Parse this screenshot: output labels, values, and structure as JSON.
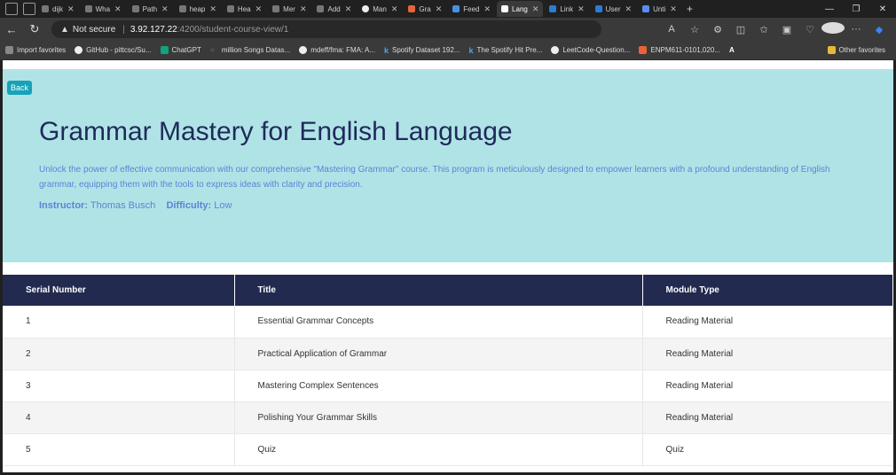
{
  "browser": {
    "tabs": [
      {
        "label": "dijk",
        "icon": "generic-tab-icon"
      },
      {
        "label": "Wha",
        "icon": "generic-tab-icon"
      },
      {
        "label": "Path",
        "icon": "generic-tab-icon"
      },
      {
        "label": "heap",
        "icon": "generic-tab-icon"
      },
      {
        "label": "Hea",
        "icon": "generic-tab-icon"
      },
      {
        "label": "Mer",
        "icon": "generic-tab-icon"
      },
      {
        "label": "Add",
        "icon": "generic-tab-icon"
      },
      {
        "label": "Man",
        "icon": "github-icon"
      },
      {
        "label": "Gra",
        "icon": "generic-tab-icon"
      },
      {
        "label": "Feed",
        "icon": "generic-tab-icon"
      },
      {
        "label": "Lang",
        "icon": "angular-icon",
        "active": true
      },
      {
        "label": "Link",
        "icon": "generic-tab-icon"
      },
      {
        "label": "User",
        "icon": "generic-tab-icon"
      },
      {
        "label": "Unti",
        "icon": "generic-tab-icon"
      }
    ],
    "not_secure": "Not secure",
    "url_host": "3.92.127.22",
    "url_path": ":4200/student-course-view/1",
    "bookmarks": [
      "Import favorites",
      "GitHub - pittcsc/Su...",
      "ChatGPT",
      "million Songs Datas...",
      "mdeff/fma: FMA: A...",
      "Spotify Dataset 192...",
      "The Spotify Hit Pre...",
      "LeetCode-Question...",
      "ENPM611-0101,020..."
    ],
    "other_favorites": "Other favorites"
  },
  "page": {
    "back_label": "Back",
    "title": "Grammar Mastery for English Language",
    "description": "Unlock the power of effective communication with our comprehensive \"Mastering Grammar\" course. This program is meticulously designed to empower learners with a profound understanding of English grammar, equipping them with the tools to express ideas with clarity and precision.",
    "instructor_label": "Instructor:",
    "instructor": "Thomas Busch",
    "difficulty_label": "Difficulty:",
    "difficulty": "Low",
    "colors": {
      "hero_bg": "#b0e3e6",
      "table_header_bg": "#222a4f",
      "title": "#1f2a5a",
      "accent_text": "#5a84d6",
      "back_button": "#17a2b8"
    }
  },
  "table": {
    "headers": [
      "Serial Number",
      "Title",
      "Module Type"
    ],
    "rows": [
      [
        "1",
        "Essential Grammar Concepts",
        "Reading Material"
      ],
      [
        "2",
        "Practical Application of Grammar",
        "Reading Material"
      ],
      [
        "3",
        "Mastering Complex Sentences",
        "Reading Material"
      ],
      [
        "4",
        "Polishing Your Grammar Skills",
        "Reading Material"
      ],
      [
        "5",
        "Quiz",
        "Quiz"
      ]
    ]
  }
}
